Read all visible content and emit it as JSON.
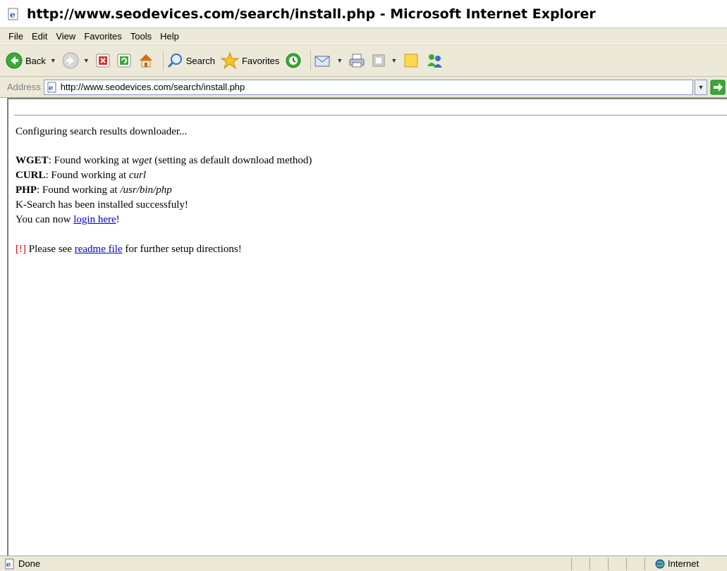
{
  "window": {
    "title": "http://www.seodevices.com/search/install.php - Microsoft Internet Explorer"
  },
  "menu": {
    "file": "File",
    "edit": "Edit",
    "view": "View",
    "favorites": "Favorites",
    "tools": "Tools",
    "help": "Help"
  },
  "toolbar": {
    "back_label": "Back",
    "search_label": "Search",
    "favorites_label": "Favorites",
    "icons": [
      "back-arrow-icon",
      "forward-arrow-icon",
      "stop-icon",
      "refresh-icon",
      "home-icon",
      "search-magnifier-icon",
      "favorites-star-icon",
      "history-icon",
      "mail-icon",
      "print-icon",
      "edit-icon",
      "notes-icon",
      "messenger-icon"
    ]
  },
  "address": {
    "label": "Address",
    "url": "http://www.seodevices.com/search/install.php"
  },
  "page": {
    "configuring": "Configuring search results downloader...",
    "wget_label": "WGET",
    "wget_text": ": Found working at ",
    "wget_path": "wget",
    "wget_note": " (setting as default download method)",
    "curl_label": "CURL",
    "curl_text": ": Found working at ",
    "curl_path": "curl",
    "php_label": "PHP",
    "php_text": ": Found working at ",
    "php_path": "/usr/bin/php",
    "installed": "K-Search has been installed successfuly!",
    "login_prefix": "You can now ",
    "login_link": "login here",
    "login_suffix": "!",
    "warn_mark": "[!]",
    "readme_prefix": " Please see ",
    "readme_link": "readme file",
    "readme_suffix": " for further setup directions!"
  },
  "status": {
    "text": "Done",
    "zone": "Internet"
  },
  "colors": {
    "chrome": "#ece9d8",
    "link": "#0000cc",
    "warning": "#cc0000"
  }
}
